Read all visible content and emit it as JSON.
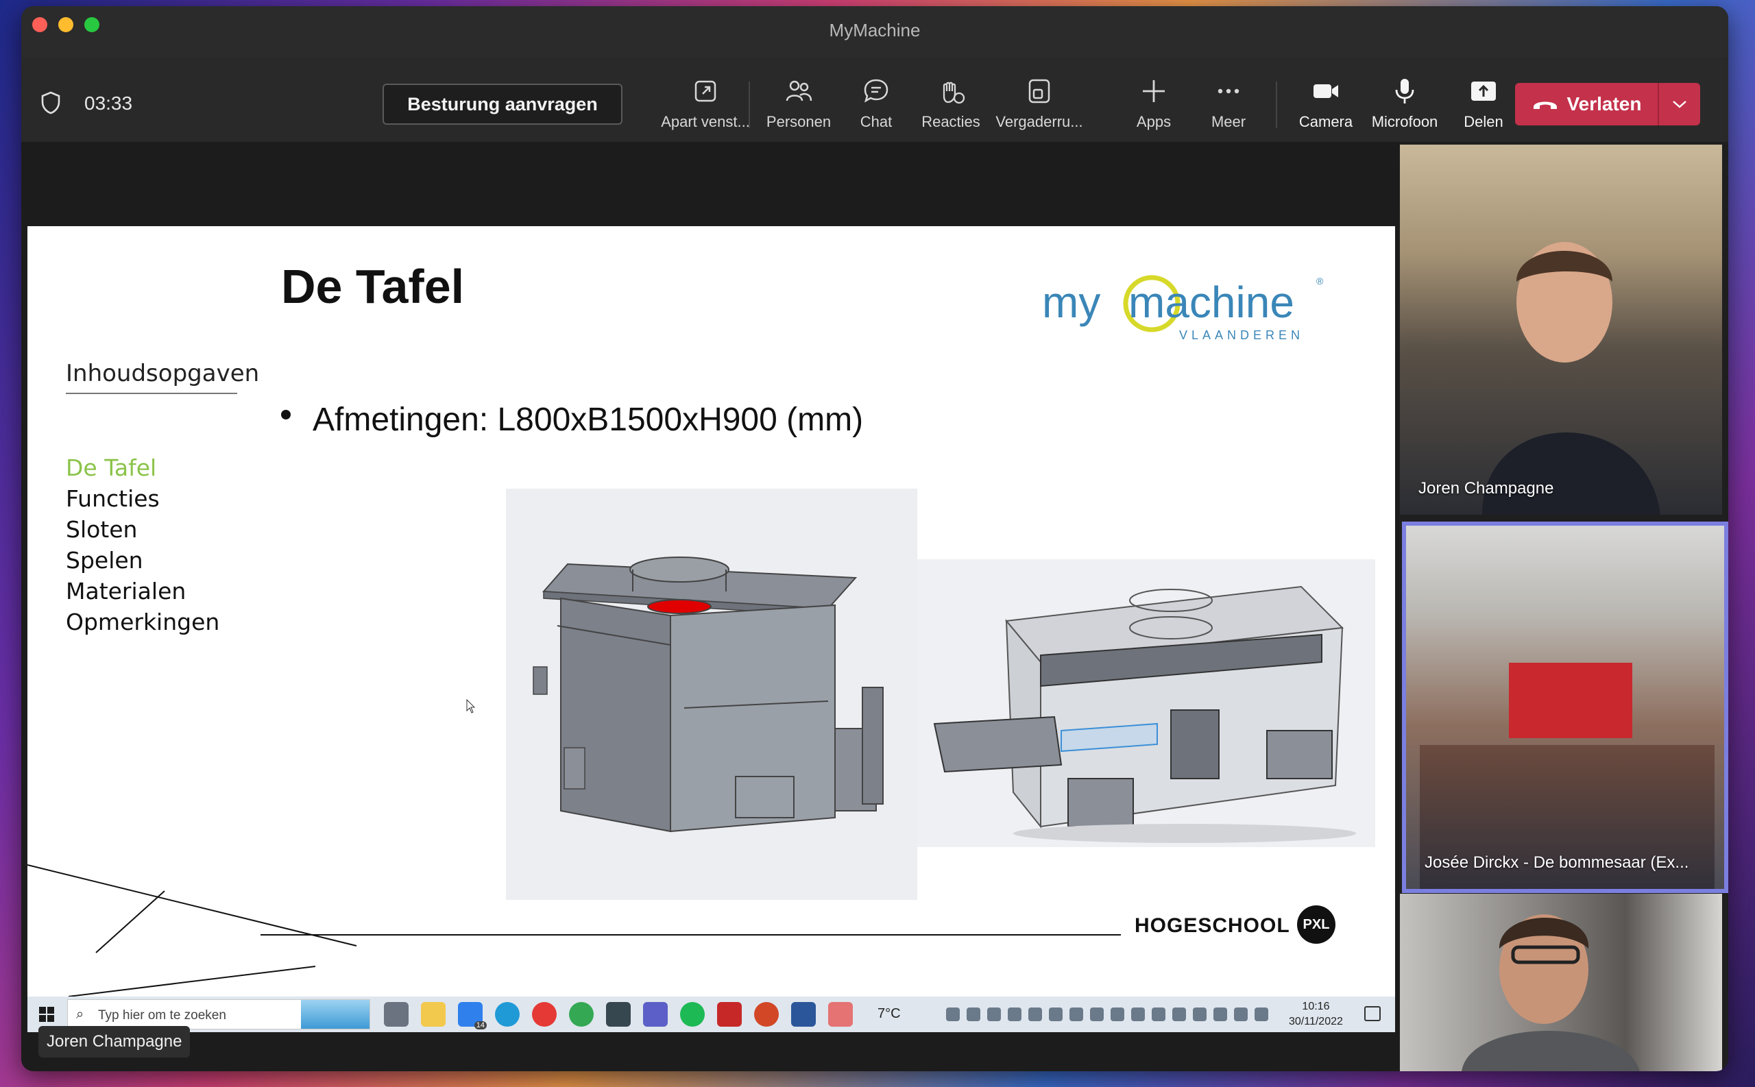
{
  "window": {
    "title": "MyMachine"
  },
  "toolbar": {
    "timer": "03:33",
    "request_control": "Besturung aanvragen",
    "tools": [
      {
        "label": "Apart venst...",
        "icon": "popout-icon"
      },
      {
        "label": "Personen",
        "icon": "people-icon"
      },
      {
        "label": "Chat",
        "icon": "chat-icon"
      },
      {
        "label": "Reacties",
        "icon": "reactions-icon"
      },
      {
        "label": "Vergaderru...",
        "icon": "rooms-icon"
      },
      {
        "label": "Apps",
        "icon": "plus-icon"
      },
      {
        "label": "Meer",
        "icon": "more-icon"
      },
      {
        "label": "Camera",
        "icon": "camera-icon"
      },
      {
        "label": "Microfoon",
        "icon": "microphone-icon"
      },
      {
        "label": "Delen",
        "icon": "share-icon"
      }
    ],
    "leave_label": "Verlaten",
    "leave_color": "#c4314b"
  },
  "slide": {
    "title": "De Tafel",
    "logo_text": "mymachine",
    "logo_sub": "VLAANDEREN",
    "toc_heading": "Inhoudsopgaven",
    "toc_items": [
      "De Tafel",
      "Functies",
      "Sloten",
      "Spelen",
      "Materialen",
      "Opmerkingen"
    ],
    "toc_active_color": "#8bc34a",
    "bullet": "Afmetingen: L800xB1500xH900 (mm)",
    "footer_brand": "HOGESCHOOL",
    "footer_badge": "PXL"
  },
  "taskbar": {
    "search_placeholder": "Typ hier om te zoeken",
    "mail_badge": "14",
    "weather": "7°C",
    "time": "10:16",
    "date": "30/11/2022"
  },
  "presenter_tag": "Joren Champagne",
  "participants": [
    {
      "name": "Joren Champagne"
    },
    {
      "name": "Josée Dirckx - De bommesaar (Ex..."
    },
    {
      "name": ""
    }
  ],
  "active_speaker_color": "#7b7fe0"
}
